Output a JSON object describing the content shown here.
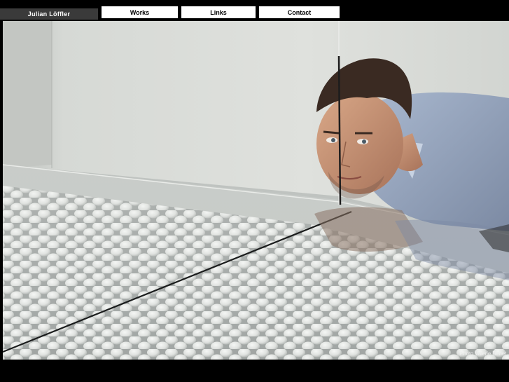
{
  "site": {
    "title": "Julian Löffler"
  },
  "nav": {
    "works": "Works",
    "links": "Links",
    "contact": "Contact"
  },
  "photo": {
    "credit": "Photo Valerie Benet"
  },
  "colors": {
    "background": "#000000",
    "title_bg": "#3a3a3a",
    "nav_bg": "#ffffff"
  }
}
